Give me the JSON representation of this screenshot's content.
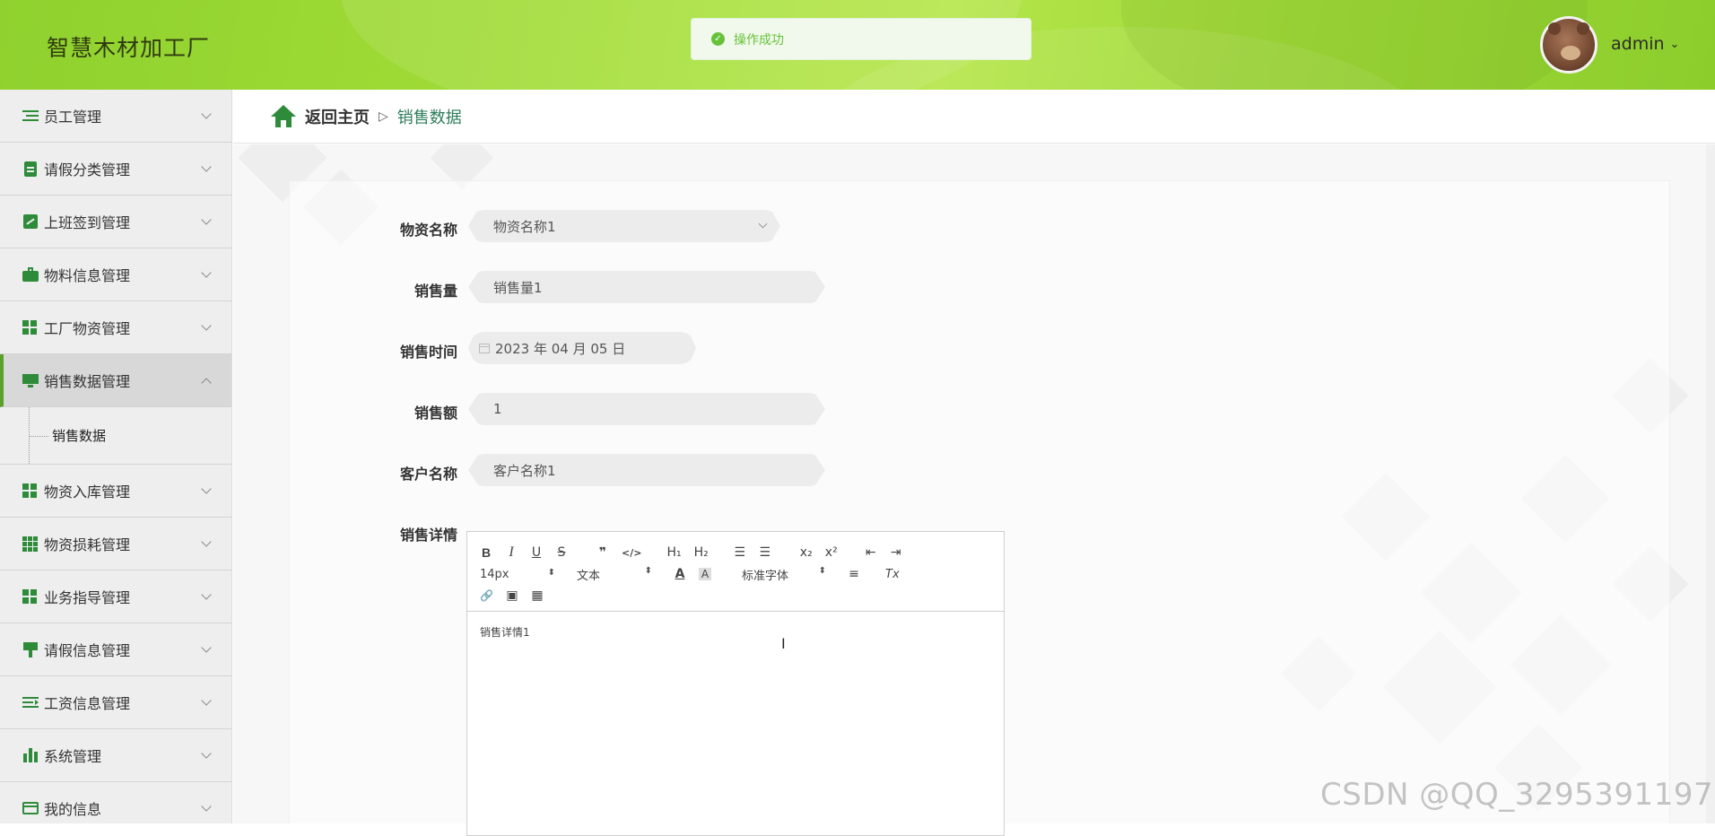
{
  "header": {
    "title": "智慧木材加工厂",
    "toast": "操作成功",
    "username": "admin",
    "accent": "#9bd834"
  },
  "sidebar": {
    "items": [
      {
        "label": "员工管理",
        "icon": "list-icon"
      },
      {
        "label": "请假分类管理",
        "icon": "clipboard-icon"
      },
      {
        "label": "上班签到管理",
        "icon": "chart-line-icon"
      },
      {
        "label": "物料信息管理",
        "icon": "briefcase-icon"
      },
      {
        "label": "工厂物资管理",
        "icon": "grid-icon"
      },
      {
        "label": "销售数据管理",
        "icon": "monitor-icon",
        "expanded": true
      },
      {
        "label": "物资入库管理",
        "icon": "grid-icon"
      },
      {
        "label": "物资损耗管理",
        "icon": "grid-dots-icon"
      },
      {
        "label": "业务指导管理",
        "icon": "grid-icon"
      },
      {
        "label": "请假信息管理",
        "icon": "brush-icon"
      },
      {
        "label": "工资信息管理",
        "icon": "indent-icon"
      },
      {
        "label": "系统管理",
        "icon": "bar-chart-icon"
      },
      {
        "label": "我的信息",
        "icon": "card-icon"
      }
    ],
    "sub_item": "销售数据"
  },
  "breadcrumb": {
    "home": "返回主页",
    "separator": "▷",
    "current": "销售数据"
  },
  "form": {
    "material_name": {
      "label": "物资名称",
      "value": "物资名称1"
    },
    "sales_volume": {
      "label": "销售量",
      "value": "销售量1"
    },
    "sales_time": {
      "label": "销售时间",
      "value": "2023 年 04 月 05 日"
    },
    "sales_amount": {
      "label": "销售额",
      "value": "1"
    },
    "customer_name": {
      "label": "客户名称",
      "value": "客户名称1"
    },
    "sales_detail": {
      "label": "销售详情",
      "value": "销售详情1"
    }
  },
  "editor": {
    "font_size": "14px",
    "block_type": "文本",
    "font_family": "标准字体",
    "buttons": {
      "bold": "B",
      "italic": "I",
      "underline": "U",
      "strike": "S",
      "quote": "❞",
      "code": "</>",
      "h1": "H₁",
      "h2": "H₂",
      "ol": "☰",
      "ul": "☰",
      "sub": "x₂",
      "sup": "x²",
      "outdent": "⇤",
      "indent": "⇥",
      "color": "A",
      "bg": "A",
      "align": "≡",
      "clean": "Tx",
      "link": "🔗",
      "image": "▣",
      "video": "▦"
    }
  },
  "watermark": "CSDN @QQ_3295391197"
}
